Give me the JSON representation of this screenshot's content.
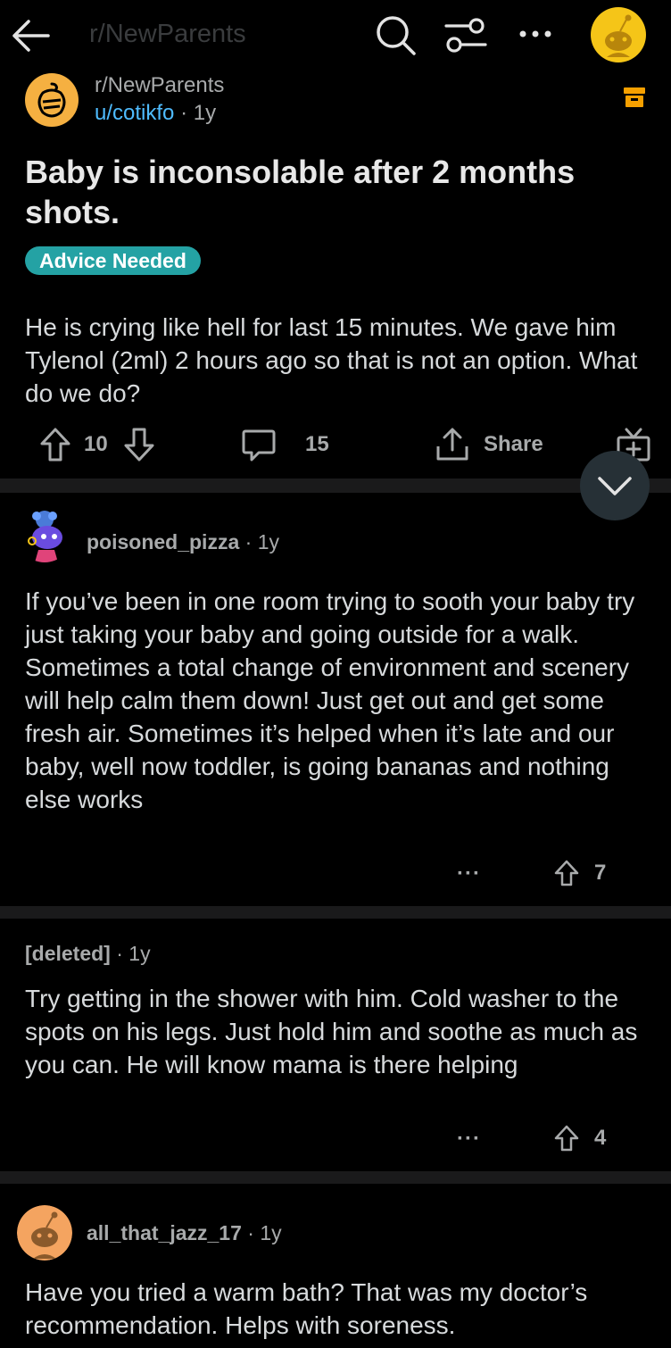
{
  "topbar": {
    "title": "r/NewParents",
    "back_icon": "arrow-left-icon",
    "search_icon": "search-icon",
    "filter_icon": "sort-filter-icon",
    "more_icon": "more-horizontal-icon",
    "avatar_icon": "user-avatar-icon"
  },
  "post": {
    "subreddit": "r/NewParents",
    "author": "u/cotikfo",
    "separator": "·",
    "age": "1y",
    "title": "Baby is inconsolable after 2 months shots.",
    "flair": "Advice Needed",
    "body": "He is crying like hell for last 15 minutes. We gave him Tylenol (2ml) 2 hours ago so that is not an option. What do we do?",
    "votes": "10",
    "comments": "15",
    "share_label": "Share",
    "flair_color": "#24a2a4"
  },
  "comments": [
    {
      "user": "poisoned_pizza",
      "age": "1y",
      "body": "If you’ve been in one room trying to sooth your baby try just taking your baby and going outside for a walk. Sometimes a total change of environment and scenery will help calm them down! Just get out and get some fresh air. Sometimes it’s helped when it’s late and our baby, well now toddler, is going bananas and nothing else works",
      "more": "···",
      "votes": "7"
    },
    {
      "user": "[deleted]",
      "age": "1y",
      "body": "Try getting in the shower with him. Cold washer to the spots on his legs. Just hold him and soothe as much as you can. He will know mama is there helping",
      "more": "···",
      "votes": "4"
    },
    {
      "user": "all_that_jazz_17",
      "age": "1y",
      "body": "Have you tried a warm bath? That was my doctor’s recommendation. Helps with soreness."
    }
  ]
}
